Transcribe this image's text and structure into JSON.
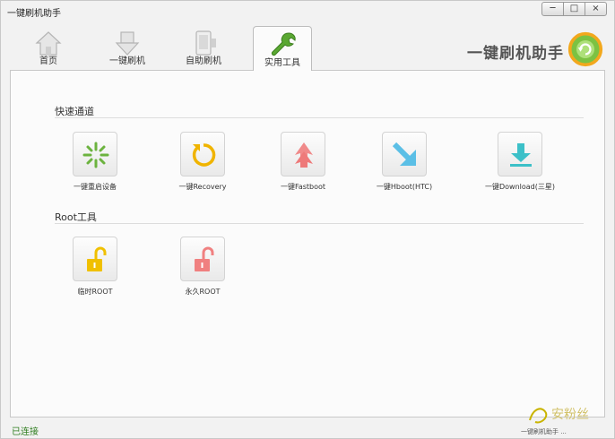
{
  "window": {
    "title": "一键刷机助手",
    "controls": [
      "─",
      "□",
      "×"
    ]
  },
  "tabs": [
    {
      "label": "首页",
      "icon": "house-icon",
      "active": false
    },
    {
      "label": "一键刷机",
      "icon": "download-arrow-icon",
      "active": false
    },
    {
      "label": "自助刷机",
      "icon": "phone-icon",
      "active": false
    },
    {
      "label": "实用工具",
      "icon": "wrench-icon",
      "active": true
    }
  ],
  "logo": {
    "text": "一键刷机助手",
    "icon": "refresh-orb-icon"
  },
  "sections": [
    {
      "title": "快速通道",
      "tools": [
        {
          "label": "一键重启设备",
          "icon": "reboot-spinner-icon",
          "color": "#6cb33f"
        },
        {
          "label": "一键Recovery",
          "icon": "circular-arrow-icon",
          "color": "#f0b400"
        },
        {
          "label": "一键Fastboot",
          "icon": "double-up-arrow-icon",
          "color": "#f08080"
        },
        {
          "label": "一键Hboot(HTC)",
          "icon": "diagonal-arrow-icon",
          "color": "#5bbfe6"
        },
        {
          "label": "一键Download(三星)",
          "icon": "download-tray-icon",
          "color": "#3cc0c8"
        }
      ]
    },
    {
      "title": "Root工具",
      "tools": [
        {
          "label": "临时ROOT",
          "icon": "unlocked-padlock-icon",
          "color": "#f0c000"
        },
        {
          "label": "永久ROOT",
          "icon": "unlocked-padlock-icon",
          "color": "#f08080"
        }
      ]
    }
  ],
  "status": {
    "text": "已连接",
    "color": "#2e7d1e"
  },
  "watermark": {
    "text": "一键刷机助手 ..."
  }
}
